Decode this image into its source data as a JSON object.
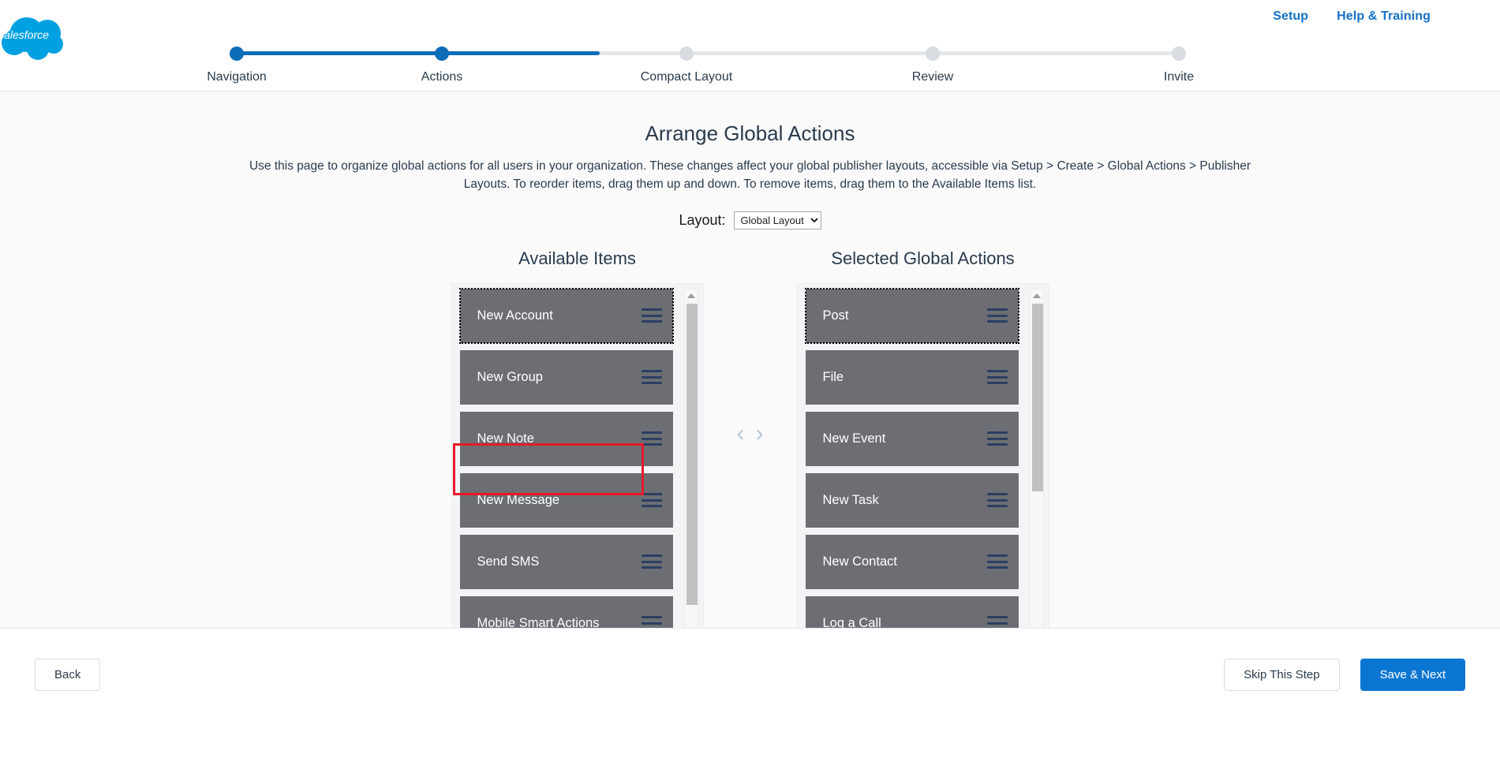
{
  "header": {
    "logo_alt": "salesforce",
    "links": [
      {
        "label": "Setup"
      },
      {
        "label": "Help & Training"
      }
    ]
  },
  "stepper": {
    "steps": [
      {
        "label": "Navigation",
        "state": "done"
      },
      {
        "label": "Actions",
        "state": "done"
      },
      {
        "label": "Compact Layout",
        "state": "todo"
      },
      {
        "label": "Review",
        "state": "todo"
      },
      {
        "label": "Invite",
        "state": "todo"
      }
    ],
    "active_color": "#0b6cb8",
    "inactive_color": "#d8dce1"
  },
  "page": {
    "title": "Arrange Global Actions",
    "description": "Use this page to organize global actions for all users in your organization. These changes affect your global publisher layouts, accessible via Setup > Create > Global Actions > Publisher Layouts. To reorder items, drag them up and down. To remove items, drag them to the Available Items list."
  },
  "layout_selector": {
    "label": "Layout:",
    "selected": "Global Layout",
    "options": [
      "Global Layout"
    ]
  },
  "available": {
    "title": "Available Items",
    "items": [
      {
        "label": "New Account",
        "focused": true,
        "highlighted": false
      },
      {
        "label": "New Group",
        "focused": false,
        "highlighted": false
      },
      {
        "label": "New Note",
        "focused": false,
        "highlighted": false
      },
      {
        "label": "New Message",
        "focused": false,
        "highlighted": true
      },
      {
        "label": "Send SMS",
        "focused": false,
        "highlighted": false
      },
      {
        "label": "Mobile Smart Actions",
        "focused": false,
        "highlighted": false
      }
    ]
  },
  "selected": {
    "title": "Selected Global Actions",
    "items": [
      {
        "label": "Post",
        "focused": true,
        "highlighted": false
      },
      {
        "label": "File",
        "focused": false,
        "highlighted": false
      },
      {
        "label": "New Event",
        "focused": false,
        "highlighted": false
      },
      {
        "label": "New Task",
        "focused": false,
        "highlighted": false
      },
      {
        "label": "New Contact",
        "focused": false,
        "highlighted": false
      },
      {
        "label": "Log a Call",
        "focused": false,
        "highlighted": false
      }
    ]
  },
  "transfer": {
    "left_label": "‹",
    "right_label": "›"
  },
  "footer": {
    "back_label": "Back",
    "skip_label": "Skip This Step",
    "save_label": "Save & Next",
    "primary_color": "#0b76d1"
  },
  "icons": {
    "drag_handle": "drag-handle-icon",
    "scroll_up": "chevron-up-icon",
    "scroll_down": "chevron-down-icon"
  },
  "annotation": {
    "target": "New Message",
    "color": "#e8192c"
  }
}
